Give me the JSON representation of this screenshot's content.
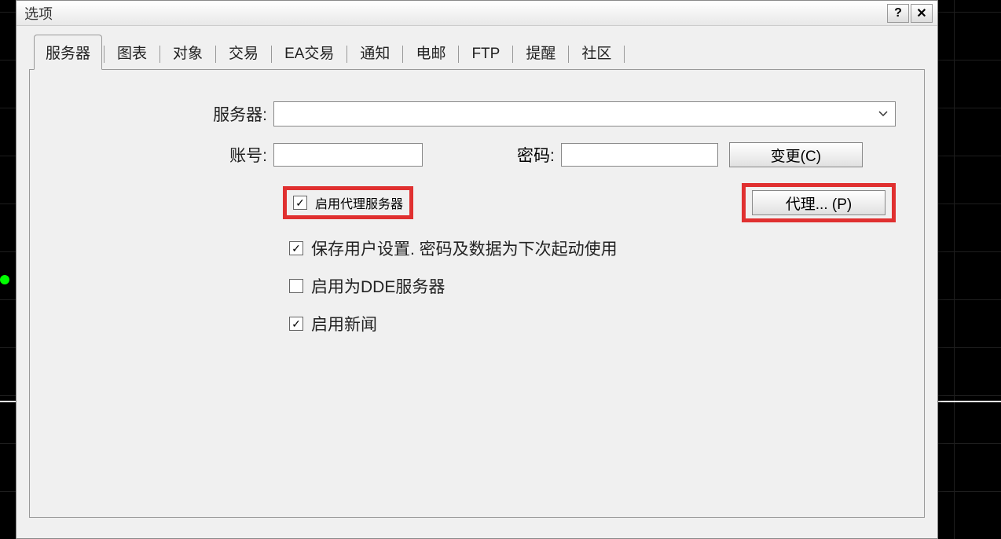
{
  "dialog": {
    "title": "选项",
    "helpBtn": "?",
    "closeBtn": "✕"
  },
  "tabs": [
    "服务器",
    "图表",
    "对象",
    "交易",
    "EA交易",
    "通知",
    "电邮",
    "FTP",
    "提醒",
    "社区"
  ],
  "form": {
    "serverLabel": "服务器:",
    "serverValue": "",
    "accountLabel": "账号:",
    "accountValue": "",
    "passwordLabel": "密码:",
    "passwordValue": "",
    "changeBtn": "变更(C)",
    "proxyBtn": "代理... (P)"
  },
  "checkboxes": {
    "enableProxy": {
      "label": "启用代理服务器",
      "checked": true
    },
    "saveSettings": {
      "label": "保存用户设置. 密码及数据为下次起动使用",
      "checked": true
    },
    "enableDDE": {
      "label": "启用为DDE服务器",
      "checked": false
    },
    "enableNews": {
      "label": "启用新闻",
      "checked": true
    }
  }
}
